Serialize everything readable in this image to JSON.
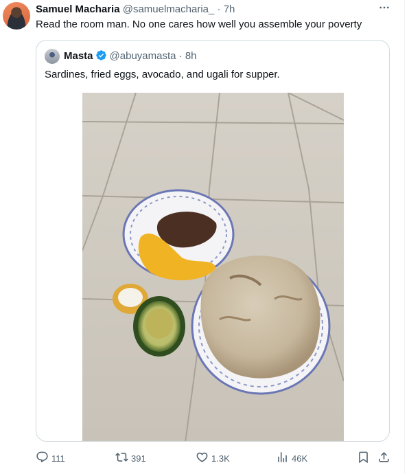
{
  "tweet": {
    "author_name": "Samuel Macharia",
    "author_handle": "@samuelmacharia_",
    "separator": "·",
    "time": "7h",
    "text": "Read the room man. No one cares how well you assemble your poverty",
    "more_icon": "more-horizontal-icon"
  },
  "quoted": {
    "author_name": "Masta",
    "author_handle": "@abuyamasta",
    "separator": "·",
    "time": "8h",
    "verified": true,
    "text": "Sardines, fried eggs, avocado, and ugali for supper.",
    "image_alt": "Plate of sardines and fried eggs, half avocado, salt and a plate of ugali on a tiled floor"
  },
  "actions": {
    "replies": "111",
    "retweets": "391",
    "likes": "1.3K",
    "views": "46K"
  },
  "colors": {
    "text_primary": "#0f1419",
    "text_secondary": "#536471",
    "border": "#cfd9de",
    "verified": "#1d9bf0"
  }
}
